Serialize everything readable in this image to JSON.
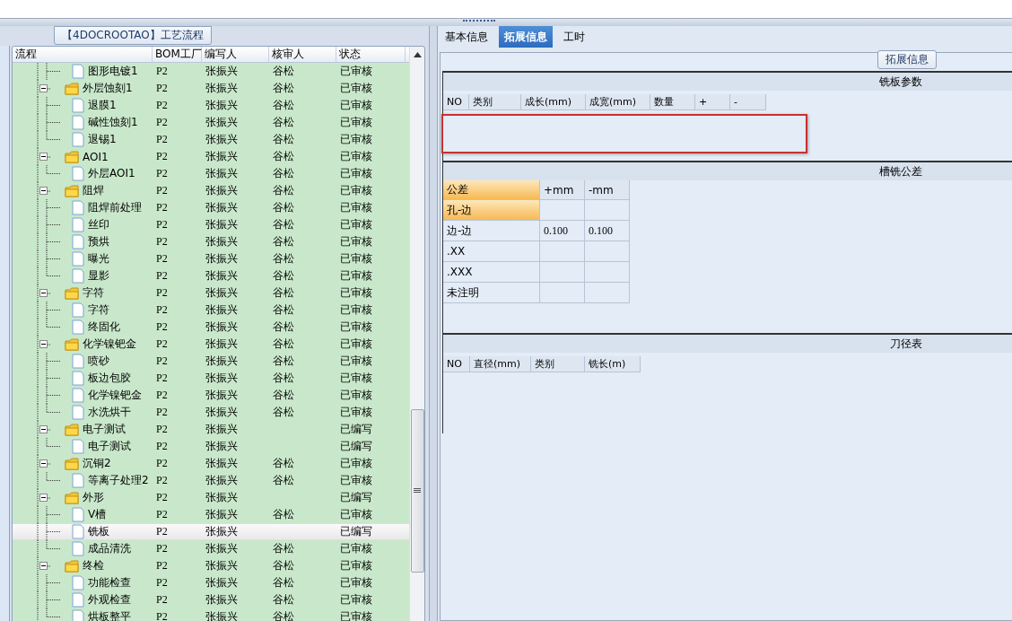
{
  "left": {
    "group_title": "【4DOCROOTAO】工艺流程",
    "columns": [
      "流程",
      "BOM工厂",
      "编写人",
      "核审人",
      "状态"
    ],
    "rows": [
      {
        "kind": "doc",
        "name": "图形电镀1",
        "bom": "P2",
        "author": "张振兴",
        "reviewer": "谷松",
        "status": "已审核",
        "selected": false
      },
      {
        "kind": "folder",
        "name": "外层蚀刻1",
        "bom": "P2",
        "author": "张振兴",
        "reviewer": "谷松",
        "status": "已审核",
        "selected": false,
        "expanded": true,
        "children": [
          {
            "kind": "doc",
            "name": "退膜1",
            "bom": "P2",
            "author": "张振兴",
            "reviewer": "谷松",
            "status": "已审核",
            "selected": false
          },
          {
            "kind": "doc",
            "name": "碱性蚀刻1",
            "bom": "P2",
            "author": "张振兴",
            "reviewer": "谷松",
            "status": "已审核",
            "selected": false
          },
          {
            "kind": "doc",
            "name": "退锡1",
            "bom": "P2",
            "author": "张振兴",
            "reviewer": "谷松",
            "status": "已审核",
            "selected": false
          }
        ]
      },
      {
        "kind": "folder",
        "name": "AOI1",
        "bom": "P2",
        "author": "张振兴",
        "reviewer": "谷松",
        "status": "已审核",
        "selected": false,
        "expanded": true,
        "children": [
          {
            "kind": "doc",
            "name": "外层AOI1",
            "bom": "P2",
            "author": "张振兴",
            "reviewer": "谷松",
            "status": "已审核",
            "selected": false
          }
        ]
      },
      {
        "kind": "folder",
        "name": "阻焊",
        "bom": "P2",
        "author": "张振兴",
        "reviewer": "谷松",
        "status": "已审核",
        "selected": false,
        "expanded": true,
        "children": [
          {
            "kind": "doc",
            "name": "阻焊前处理",
            "bom": "P2",
            "author": "张振兴",
            "reviewer": "谷松",
            "status": "已审核",
            "selected": false
          },
          {
            "kind": "doc",
            "name": "丝印",
            "bom": "P2",
            "author": "张振兴",
            "reviewer": "谷松",
            "status": "已审核",
            "selected": false
          },
          {
            "kind": "doc",
            "name": "预烘",
            "bom": "P2",
            "author": "张振兴",
            "reviewer": "谷松",
            "status": "已审核",
            "selected": false
          },
          {
            "kind": "doc",
            "name": "曝光",
            "bom": "P2",
            "author": "张振兴",
            "reviewer": "谷松",
            "status": "已审核",
            "selected": false
          },
          {
            "kind": "doc",
            "name": "显影",
            "bom": "P2",
            "author": "张振兴",
            "reviewer": "谷松",
            "status": "已审核",
            "selected": false
          }
        ]
      },
      {
        "kind": "folder",
        "name": "字符",
        "bom": "P2",
        "author": "张振兴",
        "reviewer": "谷松",
        "status": "已审核",
        "selected": false,
        "expanded": true,
        "children": [
          {
            "kind": "doc",
            "name": "字符",
            "bom": "P2",
            "author": "张振兴",
            "reviewer": "谷松",
            "status": "已审核",
            "selected": false
          },
          {
            "kind": "doc",
            "name": "终固化",
            "bom": "P2",
            "author": "张振兴",
            "reviewer": "谷松",
            "status": "已审核",
            "selected": false
          }
        ]
      },
      {
        "kind": "folder",
        "name": "化学镍钯金",
        "bom": "P2",
        "author": "张振兴",
        "reviewer": "谷松",
        "status": "已审核",
        "selected": false,
        "expanded": true,
        "children": [
          {
            "kind": "doc",
            "name": "喷砂",
            "bom": "P2",
            "author": "张振兴",
            "reviewer": "谷松",
            "status": "已审核",
            "selected": false
          },
          {
            "kind": "doc",
            "name": "板边包胶",
            "bom": "P2",
            "author": "张振兴",
            "reviewer": "谷松",
            "status": "已审核",
            "selected": false
          },
          {
            "kind": "doc",
            "name": "化学镍钯金",
            "bom": "P2",
            "author": "张振兴",
            "reviewer": "谷松",
            "status": "已审核",
            "selected": false
          },
          {
            "kind": "doc",
            "name": "水洗烘干",
            "bom": "P2",
            "author": "张振兴",
            "reviewer": "谷松",
            "status": "已审核",
            "selected": false
          }
        ]
      },
      {
        "kind": "folder",
        "name": "电子测试",
        "bom": "P2",
        "author": "张振兴",
        "status": "已编写",
        "selected": false,
        "expanded": true,
        "children": [
          {
            "kind": "doc",
            "name": "电子测试",
            "bom": "P2",
            "author": "张振兴",
            "status": "已编写",
            "selected": false
          }
        ]
      },
      {
        "kind": "folder",
        "name": "沉铜2",
        "bom": "P2",
        "author": "张振兴",
        "reviewer": "谷松",
        "status": "已审核",
        "selected": false,
        "expanded": true,
        "children": [
          {
            "kind": "doc",
            "name": "等离子处理2",
            "bom": "P2",
            "author": "张振兴",
            "reviewer": "谷松",
            "status": "已审核",
            "selected": false
          }
        ]
      },
      {
        "kind": "folder",
        "name": "外形",
        "bom": "P2",
        "author": "张振兴",
        "status": "已编写",
        "selected": false,
        "expanded": true,
        "children": [
          {
            "kind": "doc",
            "name": "V槽",
            "bom": "P2",
            "author": "张振兴",
            "reviewer": "谷松",
            "status": "已审核",
            "selected": false
          },
          {
            "kind": "doc",
            "name": "铣板",
            "bom": "P2",
            "author": "张振兴",
            "status": "已编写",
            "selected": true
          },
          {
            "kind": "doc",
            "name": "成品清洗",
            "bom": "P2",
            "author": "张振兴",
            "reviewer": "谷松",
            "status": "已审核",
            "selected": false
          }
        ]
      },
      {
        "kind": "folder",
        "name": "终检",
        "bom": "P2",
        "author": "张振兴",
        "reviewer": "谷松",
        "status": "已审核",
        "selected": false,
        "expanded": true,
        "children": [
          {
            "kind": "doc",
            "name": "功能检查",
            "bom": "P2",
            "author": "张振兴",
            "reviewer": "谷松",
            "status": "已审核",
            "selected": false
          },
          {
            "kind": "doc",
            "name": "外观检查",
            "bom": "P2",
            "author": "张振兴",
            "reviewer": "谷松",
            "status": "已审核",
            "selected": false
          },
          {
            "kind": "doc",
            "name": "烘板整平",
            "bom": "P2",
            "author": "张振兴",
            "reviewer": "谷松",
            "status": "已审核",
            "selected": false
          }
        ]
      }
    ]
  },
  "right": {
    "tabs": [
      {
        "label": "基本信息",
        "selected": false
      },
      {
        "label": "拓展信息",
        "selected": true
      },
      {
        "label": "工时",
        "selected": false
      }
    ],
    "group_title": "拓展信息",
    "milling": {
      "title": "铣板参数",
      "columns": [
        "NO",
        "类别",
        "成长(mm)",
        "成宽(mm)",
        "数量",
        "+",
        "-"
      ]
    },
    "tolerance": {
      "title": "槽铣公差",
      "columns": [
        "公差",
        "+mm",
        "-mm"
      ],
      "rows": [
        {
          "label": "孔-边",
          "selected": true
        },
        {
          "label": "边-边",
          "plus": "0.100",
          "minus": "0.100",
          "selected": false
        },
        {
          "label": ".XX",
          "selected": false
        },
        {
          "label": ".XXX",
          "selected": false
        },
        {
          "label": "未注明",
          "selected": false
        }
      ]
    },
    "tools": {
      "title": "刀径表",
      "columns": [
        "NO",
        "直径(mm)",
        "类别",
        "铣长(m)"
      ]
    }
  }
}
